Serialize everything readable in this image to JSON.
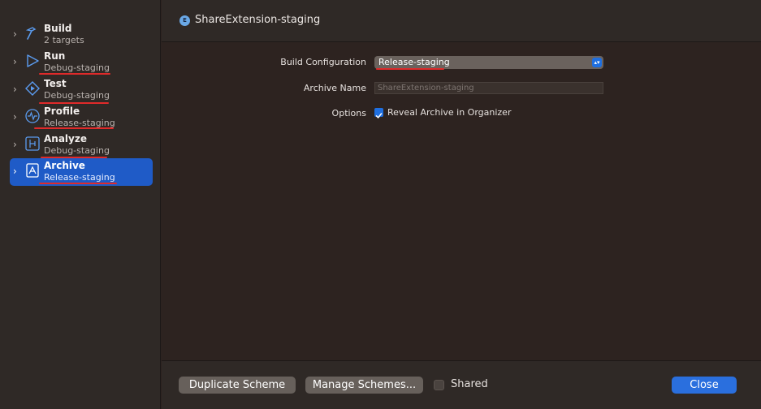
{
  "sidebar": {
    "items": [
      {
        "title": "Build",
        "subtitle": "2 targets",
        "icon": "hammer-icon"
      },
      {
        "title": "Run",
        "subtitle": "Debug-staging",
        "icon": "play-icon"
      },
      {
        "title": "Test",
        "subtitle": "Debug-staging",
        "icon": "test-diamond-icon"
      },
      {
        "title": "Profile",
        "subtitle": "Release-staging",
        "icon": "waveform-icon"
      },
      {
        "title": "Analyze",
        "subtitle": "Debug-staging",
        "icon": "analyze-icon"
      },
      {
        "title": "Archive",
        "subtitle": "Release-staging",
        "icon": "archive-icon"
      }
    ]
  },
  "header": {
    "scheme_badge": "E",
    "scheme_name": "ShareExtension-staging"
  },
  "form": {
    "build_configuration_label": "Build Configuration",
    "build_configuration_value": "Release-staging",
    "archive_name_label": "Archive Name",
    "archive_name_placeholder": "ShareExtension-staging",
    "options_label": "Options",
    "reveal_archive_label": "Reveal Archive in Organizer",
    "reveal_archive_checked": true
  },
  "footer": {
    "duplicate_label": "Duplicate Scheme",
    "manage_label": "Manage Schemes...",
    "shared_label": "Shared",
    "shared_checked": false,
    "close_label": "Close"
  },
  "colors": {
    "accent": "#1f5bc7",
    "annotation_red": "#e02a2a"
  }
}
